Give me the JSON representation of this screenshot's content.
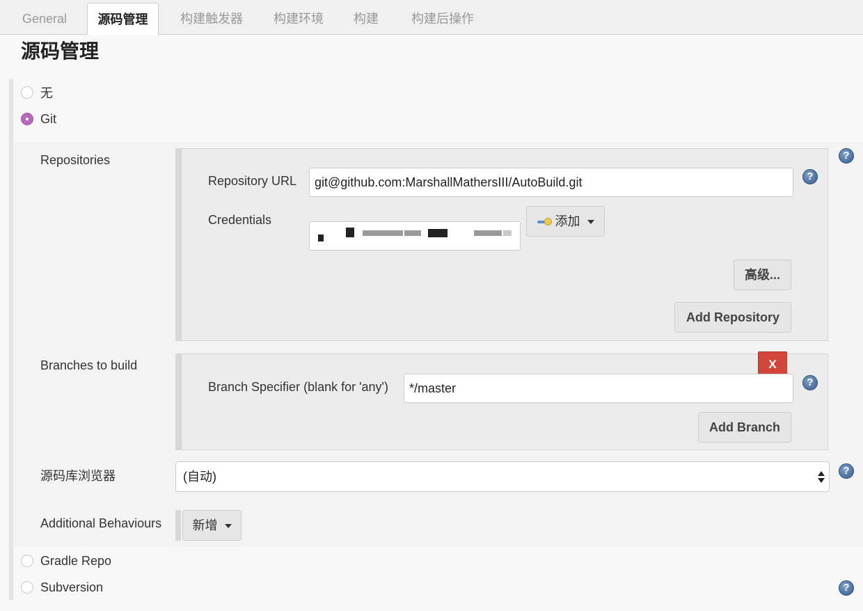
{
  "tabs": [
    {
      "label": "General",
      "active": false
    },
    {
      "label": "源码管理",
      "active": true
    },
    {
      "label": "构建触发器",
      "active": false
    },
    {
      "label": "构建环境",
      "active": false
    },
    {
      "label": "构建",
      "active": false
    },
    {
      "label": "构建后操作",
      "active": false
    }
  ],
  "page_title": "源码管理",
  "scm_options": {
    "none_label": "无",
    "git_label": "Git",
    "gradle_label": "Gradle Repo",
    "svn_label": "Subversion",
    "selected": "Git"
  },
  "git": {
    "repositories_label": "Repositories",
    "repository_url_label": "Repository URL",
    "repository_url_value": "git@github.com:MarshallMathersIII/AutoBuild.git",
    "credentials_label": "Credentials",
    "add_credentials_label": "添加",
    "advanced_label": "高级...",
    "add_repository_label": "Add Repository",
    "branches_label": "Branches to build",
    "branch_specifier_label": "Branch Specifier (blank for 'any')",
    "branch_specifier_value": "*/master",
    "delete_branch_label": "X",
    "add_branch_label": "Add Branch",
    "repo_browser_label": "源码库浏览器",
    "repo_browser_value": "(自动)",
    "additional_behaviours_label": "Additional Behaviours",
    "add_behaviour_label": "新增"
  },
  "help_icon_glyph": "?",
  "colors": {
    "radio_checked": "#b868b8",
    "delete_button": "#d2453a",
    "help_icon": "#365a8a"
  }
}
